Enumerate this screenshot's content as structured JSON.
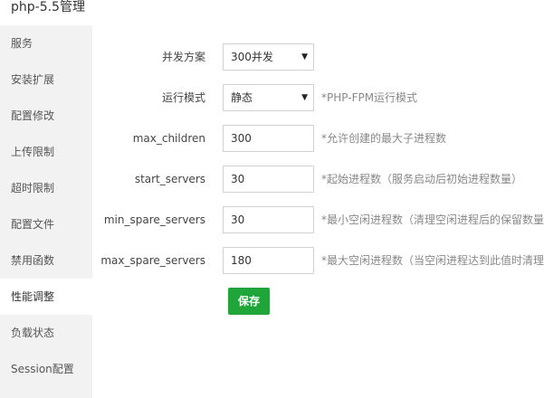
{
  "window": {
    "title": "php-5.5管理"
  },
  "sidebar": {
    "items": [
      {
        "label": "服务"
      },
      {
        "label": "安装扩展"
      },
      {
        "label": "配置修改"
      },
      {
        "label": "上传限制"
      },
      {
        "label": "超时限制"
      },
      {
        "label": "配置文件"
      },
      {
        "label": "禁用函数"
      },
      {
        "label": "性能调整",
        "active": true
      },
      {
        "label": "负载状态"
      },
      {
        "label": "Session配置"
      }
    ]
  },
  "form": {
    "concurrency": {
      "label": "并发方案",
      "value": "300并发"
    },
    "mode": {
      "label": "运行模式",
      "value": "静态",
      "hint": "*PHP-FPM运行模式"
    },
    "max_children": {
      "label": "max_children",
      "value": "300",
      "hint": "*允许创建的最大子进程数"
    },
    "start_servers": {
      "label": "start_servers",
      "value": "30",
      "hint": "*起始进程数（服务启动后初始进程数量）"
    },
    "min_spare_servers": {
      "label": "min_spare_servers",
      "value": "30",
      "hint": "*最小空闲进程数（清理空闲进程后的保留数量"
    },
    "max_spare_servers": {
      "label": "max_spare_servers",
      "value": "180",
      "hint": "*最大空闲进程数（当空闲进程达到此值时清理"
    },
    "save_label": "保存"
  },
  "colors": {
    "accent": "#20a53a",
    "sidebar_bg": "#f2f2f2"
  }
}
